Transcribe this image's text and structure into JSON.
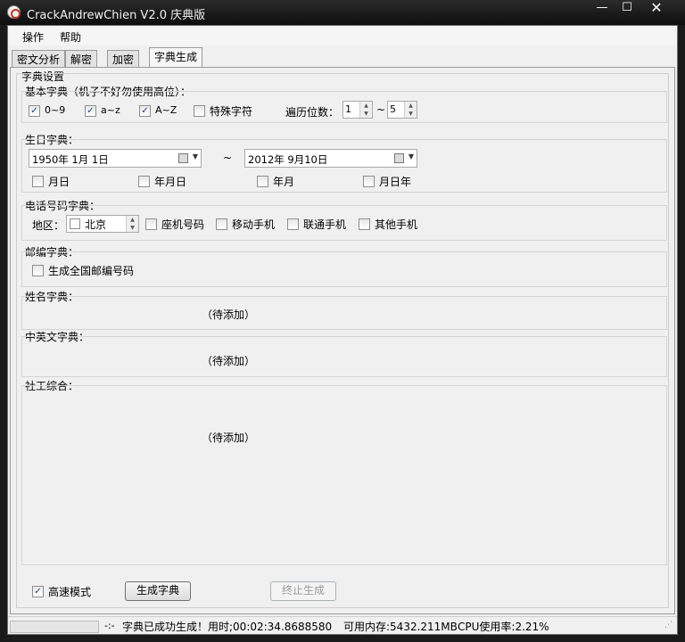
{
  "window": {
    "title": "CrackAndrewChien V2.0 庆典版",
    "minimize": "—",
    "maximize": "☐",
    "close": "✕"
  },
  "menu": [
    "操作",
    "帮助"
  ],
  "tabs": [
    "密文分析",
    "解密",
    "加密",
    "字典生成"
  ],
  "active_tab": "字典生成",
  "dict_settings": {
    "title": "字典设置",
    "basic": {
      "title": "基本字典（机子不好勿使用高位）：",
      "options": [
        {
          "label": "0~9",
          "checked": true
        },
        {
          "label": "a~z",
          "checked": true
        },
        {
          "label": "A~Z",
          "checked": true
        },
        {
          "label": "特殊字符",
          "checked": false
        }
      ],
      "digits_label": "遍历位数：",
      "digits_from": "1",
      "range_sep": "~",
      "digits_to": "5"
    },
    "birthday": {
      "title": "生日字典：",
      "date_from": "1950年  1月  1日",
      "range_sep": "~",
      "date_to": "2012年  9月10日",
      "options": [
        {
          "label": "月日",
          "checked": false
        },
        {
          "label": "年月日",
          "checked": false
        },
        {
          "label": "年月",
          "checked": false
        },
        {
          "label": "月日年",
          "checked": false
        }
      ]
    },
    "phone": {
      "title": "电话号码字典：",
      "region_label": "地区：",
      "region_value": "北京",
      "options": [
        {
          "label": "座机号码",
          "checked": false
        },
        {
          "label": "移动手机",
          "checked": false
        },
        {
          "label": "联通手机",
          "checked": false
        },
        {
          "label": "其他手机",
          "checked": false
        }
      ]
    },
    "postcode": {
      "title": "邮编字典：",
      "option": {
        "label": "生成全国邮编号码",
        "checked": false
      }
    },
    "name": {
      "title": "姓名字典：",
      "pending": "（待添加）"
    },
    "cn_en": {
      "title": "中英文字典：",
      "pending": "（待添加）"
    },
    "social": {
      "title": "社工综合：",
      "pending": "（待添加）"
    }
  },
  "bottom": {
    "fast_mode": {
      "label": "高速模式",
      "checked": true
    },
    "generate_button": "生成字典",
    "stop_button": "终止生成"
  },
  "status": {
    "progress": 0,
    "sep": "-:-",
    "message": "字典已成功生成！用时;00:02:34.8688580",
    "memory": "可用内存:5432.211MB",
    "cpu": "CPU使用率:2.21%"
  },
  "colors": {
    "progress_fill": "#06b025",
    "check_mark": "#1f3e7a"
  }
}
